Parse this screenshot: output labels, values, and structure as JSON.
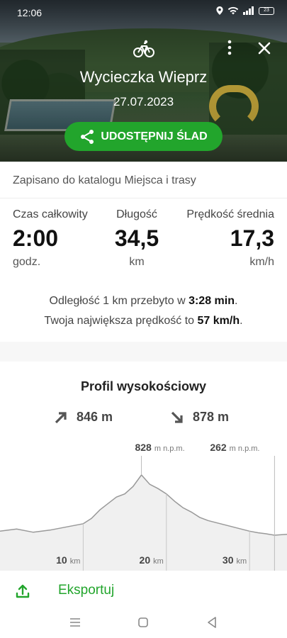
{
  "status_bar": {
    "time": "12:06",
    "battery": "23"
  },
  "hero": {
    "activity_icon": "bicycle-icon",
    "title": "Wycieczka Wieprz",
    "date": "27.07.2023",
    "share_label": "UDOSTĘPNIJ ŚLAD"
  },
  "saved_text": "Zapisano do katalogu Miejsca i trasy",
  "stats": [
    {
      "label": "Czas całkowity",
      "value": "2:00",
      "unit": "godz."
    },
    {
      "label": "Długość",
      "value": "34,5",
      "unit": "km"
    },
    {
      "label": "Prędkość średnia",
      "value": "17,3",
      "unit": "km/h"
    }
  ],
  "notes": {
    "line1_prefix": "Odległość 1 km przebyto w ",
    "line1_value": "3:28 min",
    "line1_suffix": ".",
    "line2_prefix": "Twoja największa prędkość to ",
    "line2_value": "57 km/h",
    "line2_suffix": "."
  },
  "elevation": {
    "title": "Profil wysokościowy",
    "ascent": "846 m",
    "descent": "878 m",
    "max_value": "828",
    "min_value": "262",
    "altitude_unit": "m n.p.m.",
    "distance_unit": "km",
    "ticks": [
      "10",
      "20",
      "30"
    ]
  },
  "chart_data": {
    "type": "area",
    "xlabel": "km",
    "ylabel": "m n.p.m.",
    "annotations": [
      {
        "x": 17.0,
        "y": 828,
        "label": "828"
      },
      {
        "x": 33.0,
        "y": 262,
        "label": "262"
      }
    ],
    "x": [
      0,
      2,
      4,
      6,
      8,
      10,
      11,
      12,
      13,
      14,
      15,
      16,
      17,
      18,
      19,
      20,
      21,
      22,
      23,
      24,
      25,
      26,
      27,
      28,
      29,
      30,
      31,
      32,
      33,
      34,
      34.5
    ],
    "y": [
      300,
      320,
      290,
      310,
      340,
      370,
      420,
      500,
      560,
      620,
      650,
      720,
      828,
      740,
      700,
      650,
      580,
      520,
      480,
      430,
      400,
      380,
      360,
      340,
      320,
      300,
      285,
      275,
      262,
      268,
      270
    ],
    "xticks": [
      10,
      20,
      30
    ]
  },
  "export": {
    "label": "Eksportuj",
    "icon": "upload-icon"
  },
  "nav": {
    "buttons": [
      "menu-icon",
      "home-icon",
      "back-icon"
    ]
  }
}
